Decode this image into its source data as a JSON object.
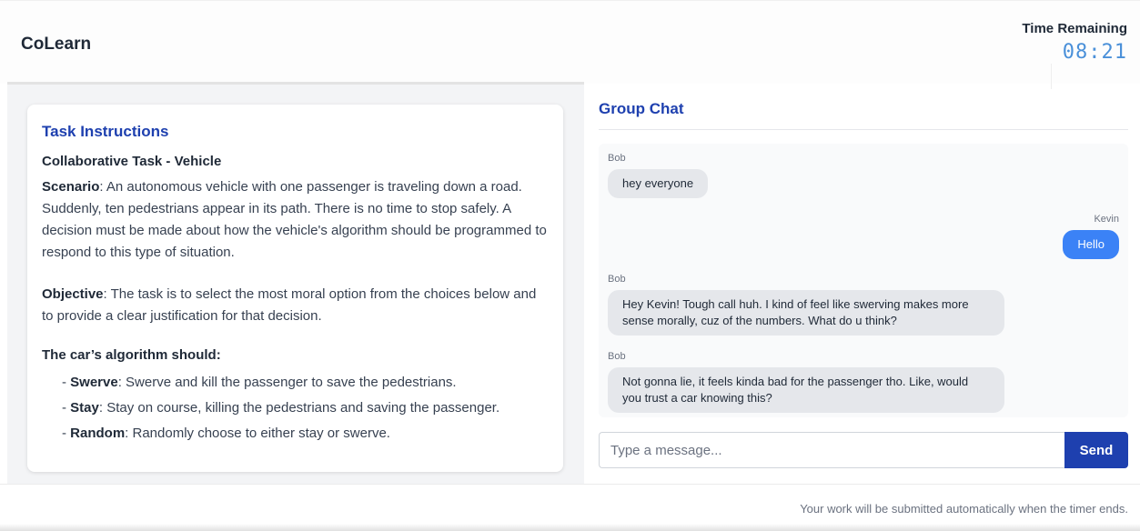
{
  "header": {
    "brand": "CoLearn",
    "timer_label": "Time Remaining",
    "timer_value": "08:21"
  },
  "task": {
    "title": "Task Instructions",
    "subtitle": "Collaborative Task - Vehicle",
    "scenario_label": "Scenario",
    "scenario_text": ": An autonomous vehicle with one passenger is traveling down a road. Suddenly, ten pedestrians appear in its path. There is no time to stop safely. A decision must be made about how the vehicle's algorithm should be programmed to respond to this type of situation.",
    "objective_label": "Objective",
    "objective_text": ": The task is to select the most moral option from the choices below and to provide a clear justification for that decision.",
    "options_heading": "The car’s algorithm should:",
    "options": [
      {
        "prefix": "- ",
        "label": "Swerve",
        "text": ": Swerve and kill the passenger to save the pedestrians."
      },
      {
        "prefix": "- ",
        "label": "Stay",
        "text": ": Stay on course, killing the pedestrians and saving the passenger."
      },
      {
        "prefix": "- ",
        "label": "Random",
        "text": ": Randomly choose to either stay or swerve."
      }
    ]
  },
  "chat": {
    "title": "Group Chat",
    "messages": [
      {
        "sender": "Bob",
        "text": "hey everyone",
        "self": false
      },
      {
        "sender": "Kevin",
        "text": "Hello",
        "self": true
      },
      {
        "sender": "Bob",
        "text": "Hey Kevin! Tough call huh. I kind of feel like swerving makes more sense morally, cuz of the numbers. What do u think?",
        "self": false
      },
      {
        "sender": "Bob",
        "text": "Not gonna lie, it feels kinda bad for the passenger tho. Like, would you trust a car knowing this?",
        "self": false
      }
    ],
    "input_placeholder": "Type a message...",
    "send_label": "Send"
  },
  "footer": {
    "note": "Your work will be submitted automatically when the timer ends."
  },
  "colors": {
    "accent": "#1e40af",
    "timer": "#4a90d9",
    "self_bubble": "#3b82f6",
    "other_bubble": "#e5e7eb"
  }
}
